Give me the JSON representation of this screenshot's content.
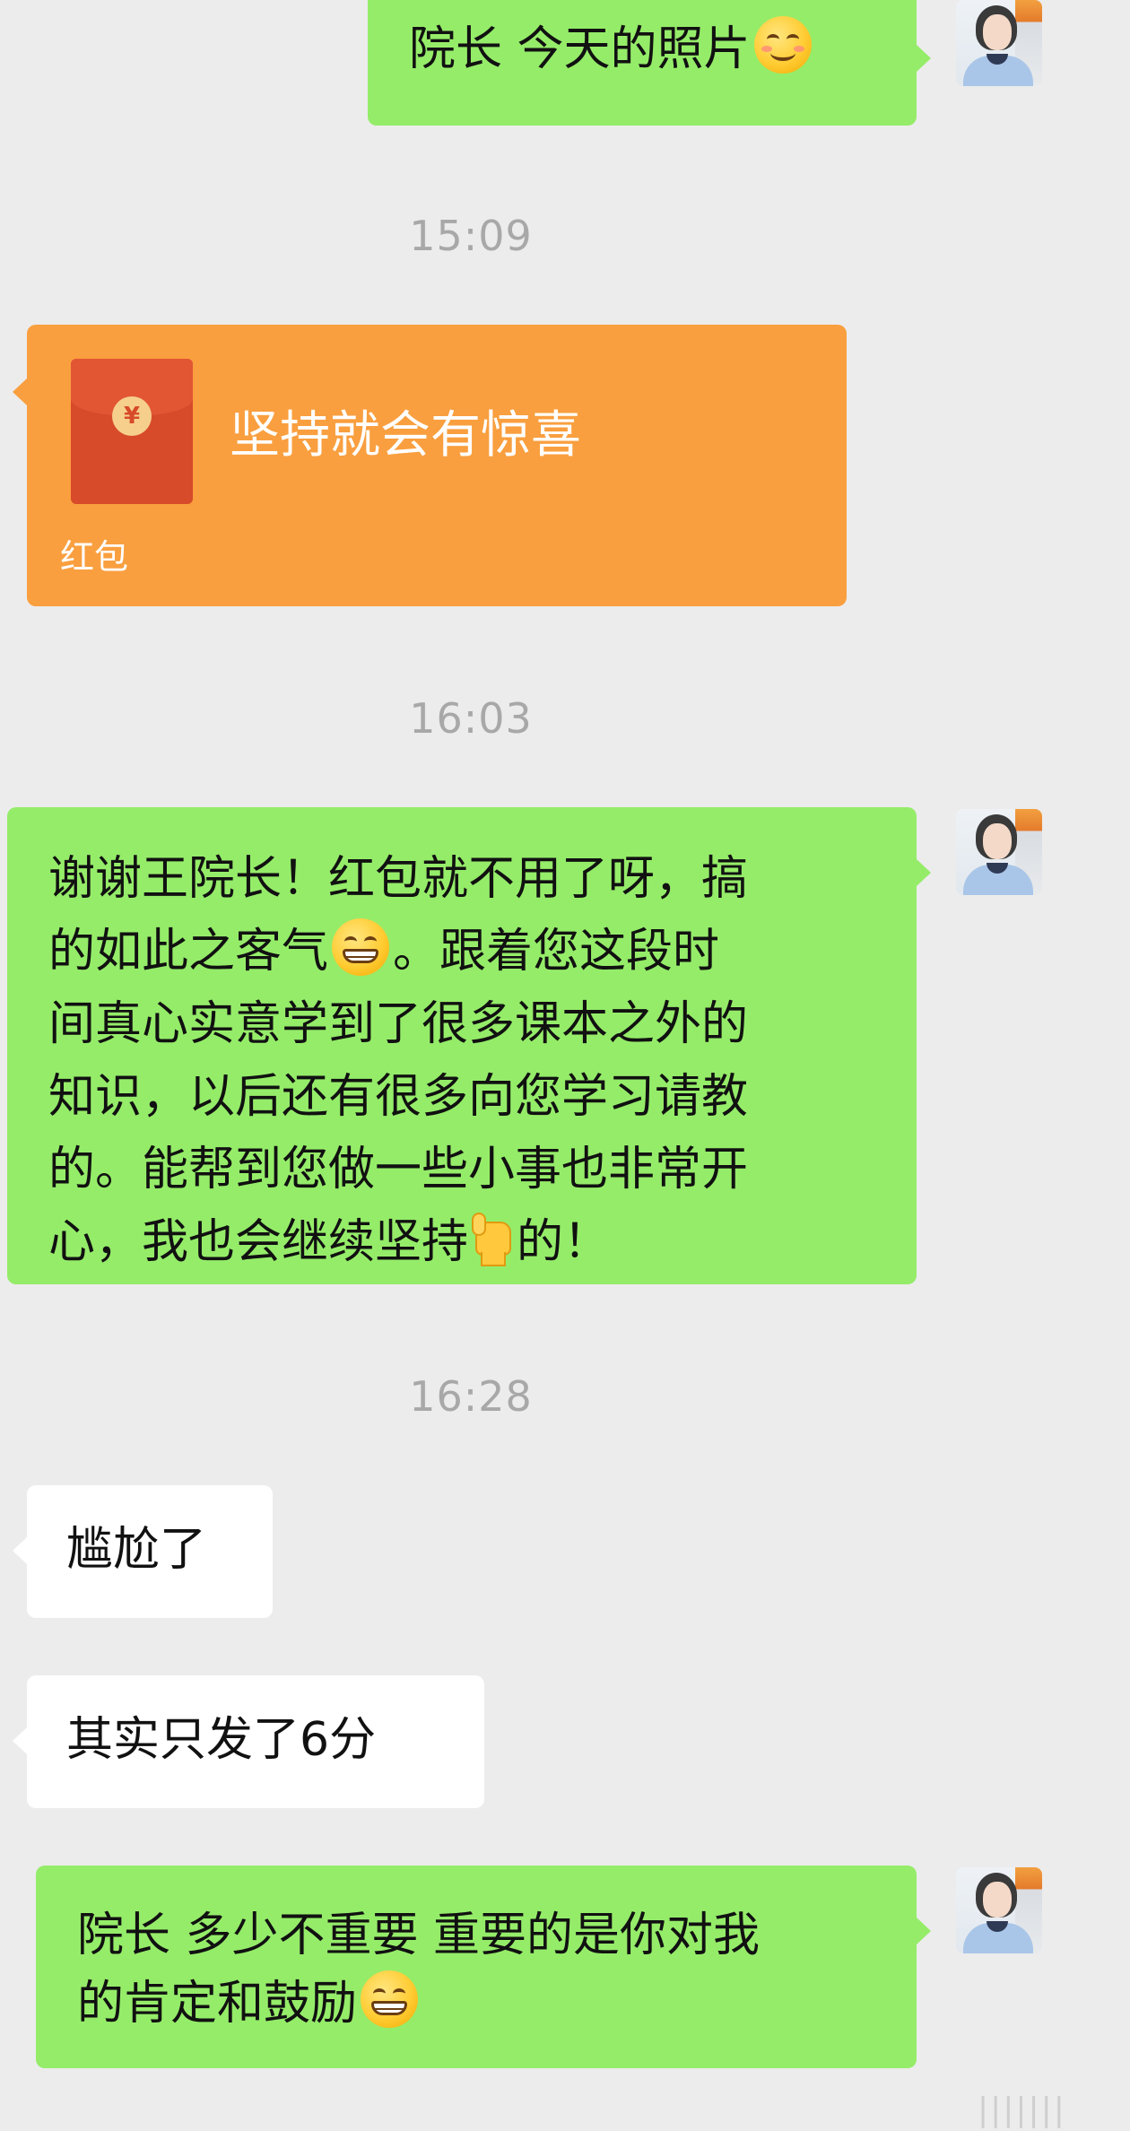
{
  "messages": {
    "m1": {
      "text": "院长 今天的照片",
      "emoji": "smiling-face-icon"
    },
    "t1": "15:09",
    "packet": {
      "title": "坚持就会有惊喜",
      "label": "红包",
      "symbol": "¥"
    },
    "t2": "16:03",
    "m2": {
      "line1": "谢谢王院长！红包就不用了呀，搞",
      "line2a": "的如此之客气",
      "line2b": "。跟着您这段时",
      "line3": "间真心实意学到了很多课本之外的",
      "line4": "知识，以后还有很多向您学习请教",
      "line5": "的。能帮到您做一些小事也非常开",
      "line6a": "心，我也会继续坚持",
      "line6b": "的！"
    },
    "t3": "16:28",
    "m3": "尴尬了",
    "m4": "其实只发了6分",
    "m5": {
      "line1": "院长 多少不重要 重要的是你对我",
      "line2": "的肯定和鼓励"
    }
  },
  "watermark": "|||||||",
  "colors": {
    "background": "#ececec",
    "sent_bubble": "#95ec69",
    "received_bubble": "#ffffff",
    "red_packet": "#f99f3f",
    "timestamp": "#a8a8a8"
  }
}
